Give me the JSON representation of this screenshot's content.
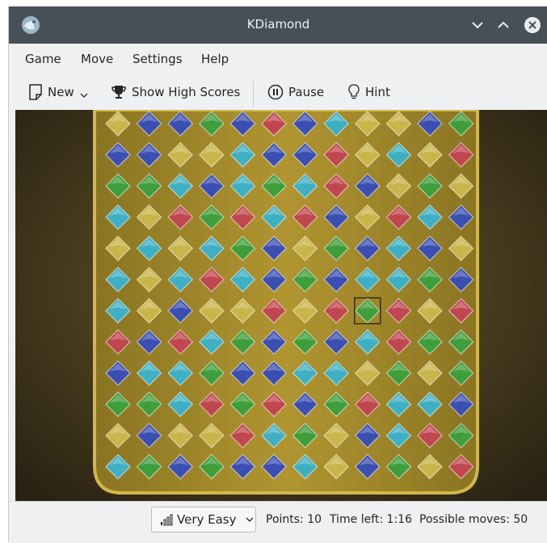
{
  "window": {
    "title": "KDiamond"
  },
  "icons": {
    "app": "kdiamond-icon",
    "minimize": "chevron-down-icon",
    "maximize": "chevron-up-icon",
    "close": "close-icon",
    "new": "new-document-icon",
    "high_scores": "trophy-icon",
    "pause": "pause-icon",
    "hint": "lightbulb-icon",
    "difficulty": "signal-bars-icon"
  },
  "menu": {
    "game": "Game",
    "move": "Move",
    "settings": "Settings",
    "help": "Help"
  },
  "toolbar": {
    "new_label": "New",
    "high_scores_label": "Show High Scores",
    "pause_label": "Pause",
    "hint_label": "Hint"
  },
  "board": {
    "columns": 12,
    "rows": 12,
    "selected": {
      "row": 6,
      "col": 8
    },
    "colors": {
      "Y": "#c9b54a",
      "B": "#3b4fb3",
      "G": "#3f9e3c",
      "C": "#3fb0c4",
      "R": "#c0464f"
    },
    "grid": [
      [
        "Y",
        "B",
        "B",
        "G",
        "B",
        "R",
        "B",
        "C",
        "Y",
        "Y",
        "B",
        "G"
      ],
      [
        "B",
        "B",
        "Y",
        "Y",
        "C",
        "B",
        "B",
        "R",
        "Y",
        "C",
        "Y",
        "R"
      ],
      [
        "G",
        "G",
        "C",
        "B",
        "C",
        "G",
        "C",
        "R",
        "B",
        "Y",
        "G",
        "Y"
      ],
      [
        "C",
        "Y",
        "R",
        "G",
        "R",
        "C",
        "R",
        "B",
        "Y",
        "R",
        "C",
        "B"
      ],
      [
        "Y",
        "C",
        "Y",
        "C",
        "G",
        "B",
        "Y",
        "G",
        "B",
        "C",
        "B",
        "Y"
      ],
      [
        "C",
        "Y",
        "C",
        "R",
        "C",
        "B",
        "G",
        "B",
        "C",
        "C",
        "G",
        "B"
      ],
      [
        "C",
        "Y",
        "B",
        "Y",
        "Y",
        "R",
        "Y",
        "R",
        "G",
        "R",
        "Y",
        "R"
      ],
      [
        "R",
        "B",
        "R",
        "C",
        "G",
        "B",
        "G",
        "B",
        "C",
        "R",
        "G",
        "G"
      ],
      [
        "B",
        "C",
        "C",
        "G",
        "B",
        "B",
        "C",
        "C",
        "Y",
        "G",
        "Y",
        "G"
      ],
      [
        "G",
        "G",
        "C",
        "R",
        "G",
        "R",
        "B",
        "G",
        "R",
        "C",
        "C",
        "B"
      ],
      [
        "Y",
        "B",
        "Y",
        "Y",
        "R",
        "C",
        "G",
        "Y",
        "B",
        "C",
        "R",
        "G"
      ],
      [
        "C",
        "G",
        "B",
        "G",
        "B",
        "B",
        "C",
        "Y",
        "B",
        "G",
        "Y",
        "R"
      ]
    ]
  },
  "status": {
    "difficulty": "Very Easy",
    "points": "Points: 10",
    "time_left": "Time left: 1:16",
    "possible_moves": "Possible moves: 50"
  }
}
